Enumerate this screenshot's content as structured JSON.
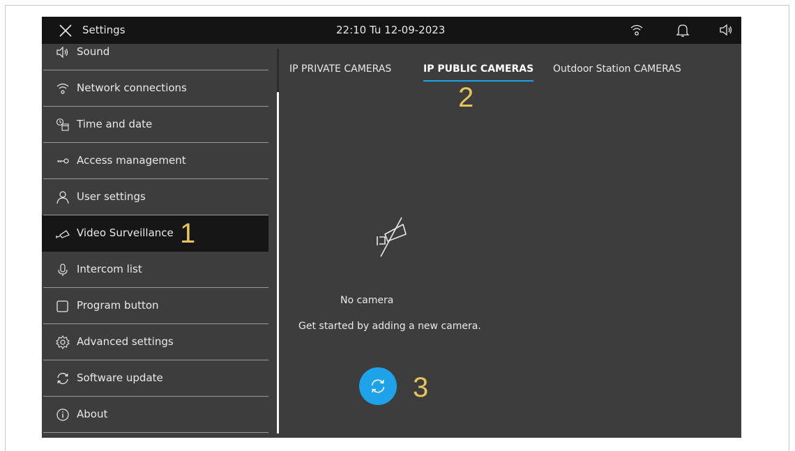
{
  "topbar": {
    "title": "Settings",
    "datetime": "22:10  Tu 12-09-2023",
    "icons": [
      "close-icon",
      "wifi-icon",
      "bell-icon",
      "speaker-icon"
    ]
  },
  "sidebar": {
    "items": [
      {
        "label": "Sound",
        "icon": "speaker-icon"
      },
      {
        "label": "Network connections",
        "icon": "wifi-icon"
      },
      {
        "label": "Time and date",
        "icon": "clock-calendar-icon"
      },
      {
        "label": "Access  management",
        "icon": "key-icon"
      },
      {
        "label": "User settings",
        "icon": "user-icon"
      },
      {
        "label": "Video Surveillance",
        "icon": "camera-icon",
        "active": true
      },
      {
        "label": "Intercom list",
        "icon": "microphone-icon"
      },
      {
        "label": "Program button",
        "icon": "square-button-icon"
      },
      {
        "label": "Advanced settings",
        "icon": "gear-icon"
      },
      {
        "label": "Software update",
        "icon": "refresh-icon"
      },
      {
        "label": "About",
        "icon": "info-icon"
      }
    ]
  },
  "tabs": [
    {
      "label": "IP PRIVATE CAMERAS",
      "active": false
    },
    {
      "label": "IP PUBLIC CAMERAS",
      "active": true
    },
    {
      "label": "Outdoor Station CAMERAS",
      "active": false
    }
  ],
  "empty_state": {
    "icon": "camera-off-icon",
    "title": "No camera",
    "subtitle": "Get started by adding a new camera."
  },
  "refresh_button": {
    "icon": "refresh-icon",
    "color": "#1ea3ea"
  },
  "callouts": {
    "one": "1",
    "two": "2",
    "three": "3"
  },
  "colors": {
    "accent": "#1aa3e6",
    "callout": "#e7c45a",
    "background": "#3d3d3d",
    "topbar": "#141414"
  }
}
